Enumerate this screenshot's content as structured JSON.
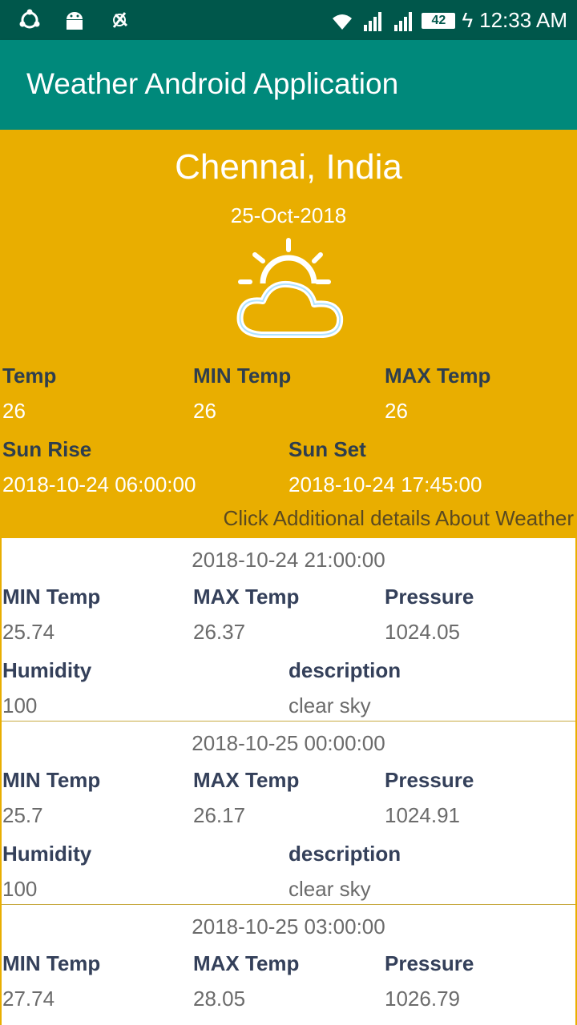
{
  "status_bar": {
    "time": "12:33 AM",
    "battery": "42"
  },
  "app_title": "Weather Android Application",
  "current": {
    "city": "Chennai, India",
    "date": "25-Oct-2018",
    "temp_label": "Temp",
    "temp": "26",
    "min_label": "MIN Temp",
    "min": "26",
    "max_label": "MAX Temp",
    "max": "26",
    "sunrise_label": "Sun Rise",
    "sunrise": "2018-10-24 06:00:00",
    "sunset_label": "Sun Set",
    "sunset": "2018-10-24 17:45:00",
    "more_link": "Click Additional details About Weather"
  },
  "labels": {
    "min": "MIN Temp",
    "max": "MAX Temp",
    "pressure": "Pressure",
    "humidity": "Humidity",
    "description": "description"
  },
  "forecasts": [
    {
      "timestamp": "2018-10-24 21:00:00",
      "min": "25.74",
      "max": "26.37",
      "pressure": "1024.05",
      "humidity": "100",
      "description": "clear sky"
    },
    {
      "timestamp": "2018-10-25 00:00:00",
      "min": "25.7",
      "max": "26.17",
      "pressure": "1024.91",
      "humidity": "100",
      "description": "clear sky"
    },
    {
      "timestamp": "2018-10-25 03:00:00",
      "min": "27.74",
      "max": "28.05",
      "pressure": "1026.79"
    }
  ],
  "colors": {
    "status_bar": "#00574b",
    "app_bar": "#00897b",
    "hero": "#e9ae00"
  }
}
